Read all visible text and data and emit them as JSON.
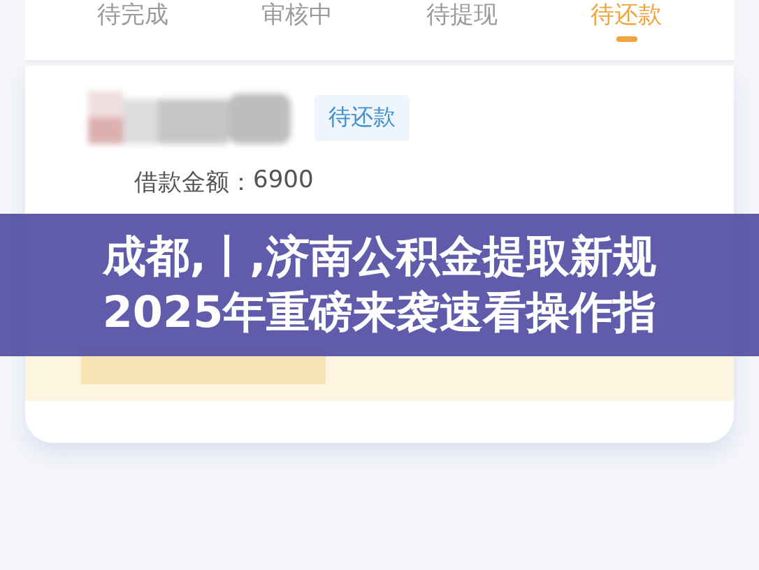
{
  "tabs": [
    {
      "label": "待完成",
      "selected": false
    },
    {
      "label": "审核中",
      "selected": false
    },
    {
      "label": "待提现",
      "selected": false
    },
    {
      "label": "待还款",
      "selected": true
    }
  ],
  "loan": {
    "status": "待还款",
    "amount_label": "借款金额：",
    "amount": "6900"
  },
  "headline": {
    "lines": [
      "成都,丨,济南公积金提取新规",
      "2025年重磅来袭速看操作指"
    ]
  }
}
